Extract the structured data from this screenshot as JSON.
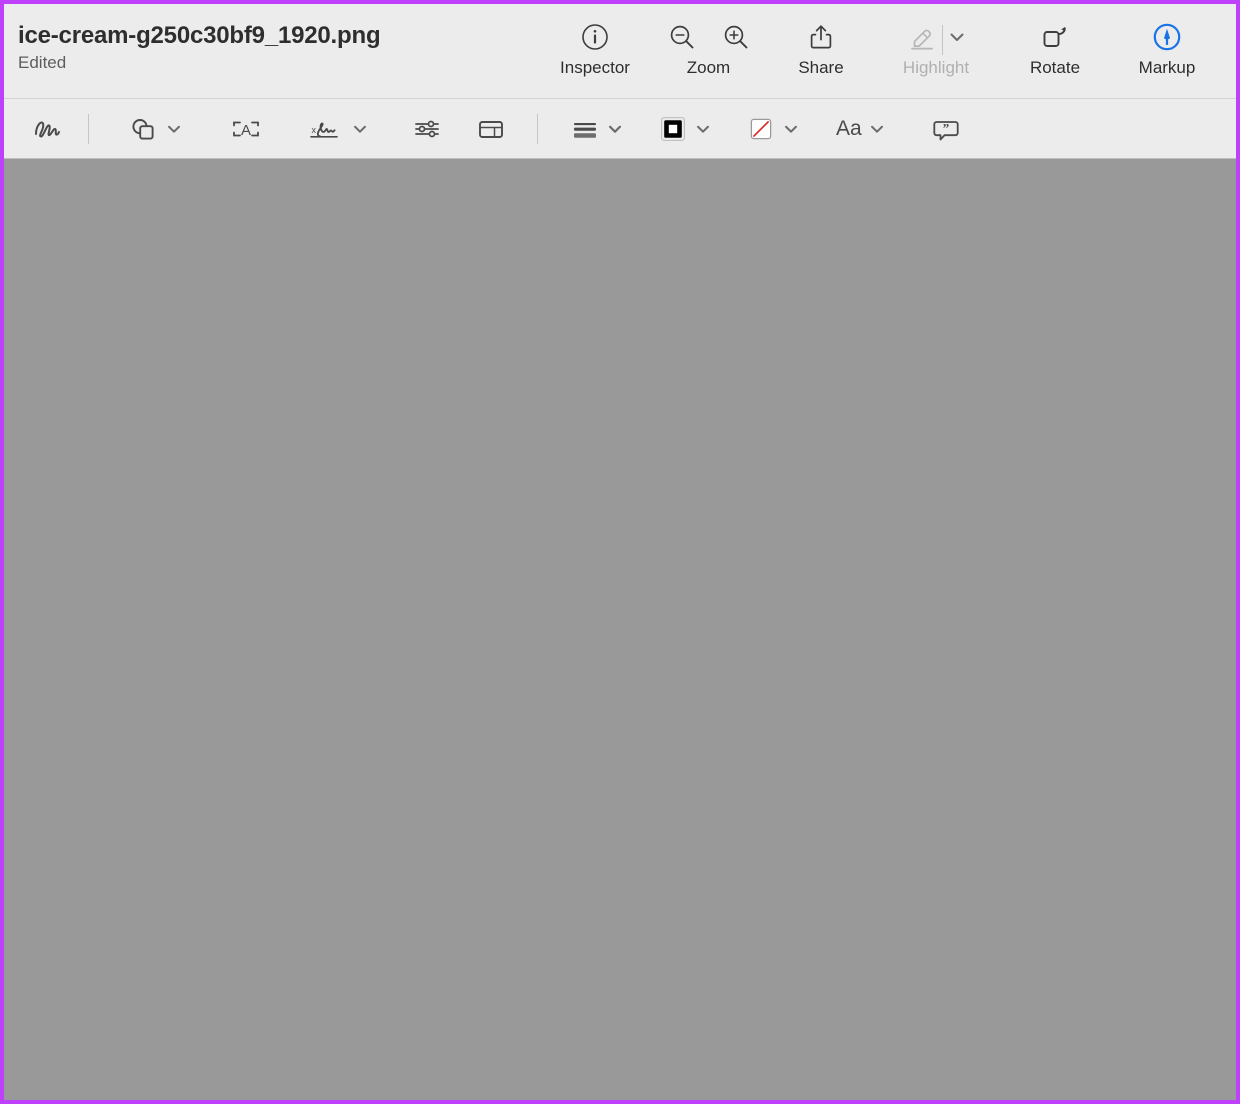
{
  "window": {
    "border_color": "#bf40fb",
    "toolbar_bg": "#ececec",
    "canvas_bg": "#999999"
  },
  "header": {
    "title": "ice-cream-g250c30bf9_1920.png",
    "subtitle": "Edited"
  },
  "main_toolbar": {
    "items": [
      {
        "id": "inspector",
        "label": "Inspector",
        "icon": "info-circle-icon",
        "enabled": true
      },
      {
        "id": "zoom",
        "label": "Zoom",
        "icon_out": "magnifier-minus-icon",
        "icon_in": "magnifier-plus-icon",
        "enabled": true
      },
      {
        "id": "share",
        "label": "Share",
        "icon": "share-upload-icon",
        "enabled": true
      },
      {
        "id": "highlight",
        "label": "Highlight",
        "icon": "highlighter-pen-icon",
        "enabled": false,
        "has_chevron": true
      },
      {
        "id": "rotate",
        "label": "Rotate",
        "icon": "rotate-left-icon",
        "enabled": true
      },
      {
        "id": "markup",
        "label": "Markup",
        "icon": "markup-pen-circle-icon",
        "enabled": true,
        "active": true,
        "active_color": "#1a73e8"
      }
    ]
  },
  "markup_toolbar": {
    "items": [
      {
        "id": "sketch",
        "name": "sketch-tool",
        "icon": "scribble-icon",
        "has_chevron": false
      },
      {
        "id": "shapes",
        "name": "shapes-tool",
        "icon": "shapes-icon",
        "has_chevron": true
      },
      {
        "id": "text",
        "name": "text-tool",
        "icon": "text-box-a-icon",
        "has_chevron": false
      },
      {
        "id": "signature",
        "name": "signature-tool",
        "icon": "signature-icon",
        "has_chevron": true
      },
      {
        "id": "adjust-color",
        "name": "adjust-color-tool",
        "icon": "sliders-icon",
        "has_chevron": false
      },
      {
        "id": "adjust-size",
        "name": "adjust-size-tool",
        "icon": "crop-frame-icon",
        "has_chevron": false
      },
      {
        "id": "shape-style",
        "name": "shape-style-tool",
        "icon": "line-weights-icon",
        "has_chevron": true
      },
      {
        "id": "border-color",
        "name": "border-color-tool",
        "icon": "border-color-swatch-icon",
        "has_chevron": true,
        "swatch": "#000000"
      },
      {
        "id": "fill-color",
        "name": "fill-color-tool",
        "icon": "fill-color-none-swatch-icon",
        "has_chevron": true,
        "swatch": "#ffffff",
        "slash_color": "#e02020"
      },
      {
        "id": "text-style",
        "name": "text-style-tool",
        "label": "Aa",
        "has_chevron": true
      },
      {
        "id": "annotate",
        "name": "annotate-tool",
        "icon": "speech-bubble-quote-icon",
        "has_chevron": false
      }
    ]
  }
}
